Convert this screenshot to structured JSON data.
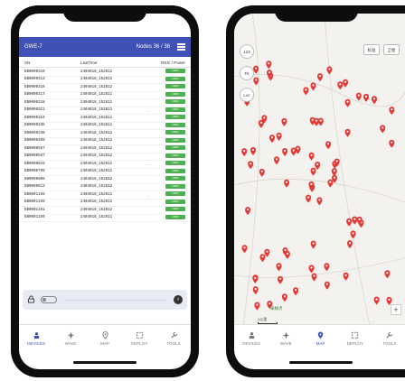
{
  "left_phone": {
    "appbar": {
      "title": "GWE-7",
      "nodes": "Nodes 36 / 36"
    },
    "table": {
      "headers": [
        "SN",
        "LastTime",
        "RSSI / Power"
      ],
      "rows": [
        {
          "sn": "EB0000310",
          "time": "2404018_152812",
          "sig": "",
          "pw": "100%"
        },
        {
          "sn": "EB0000313",
          "time": "2404018_152812",
          "sig": "",
          "pw": "100%"
        },
        {
          "sn": "EB0000316",
          "time": "2404018_152812",
          "sig": "",
          "pw": "100%"
        },
        {
          "sn": "EB0000317",
          "time": "2404018_152811",
          "sig": "",
          "pw": "100%"
        },
        {
          "sn": "EB0000318",
          "time": "2404018_152812",
          "sig": "",
          "pw": "100%"
        },
        {
          "sn": "EB0000321",
          "time": "2404018_152811",
          "sig": "..",
          "pw": "100%"
        },
        {
          "sn": "EB0000324",
          "time": "2404018_152811",
          "sig": "",
          "pw": "100%"
        },
        {
          "sn": "EB0000335",
          "time": "2404018_152811",
          "sig": "",
          "pw": "100%"
        },
        {
          "sn": "EB0000338",
          "time": "2404018_152812",
          "sig": "",
          "pw": "100%"
        },
        {
          "sn": "EB0000409",
          "time": "2404018_152812",
          "sig": "",
          "pw": "100%"
        },
        {
          "sn": "EB0000567",
          "time": "2404018_152812",
          "sig": "",
          "pw": "100%"
        },
        {
          "sn": "EB0000597",
          "time": "2404018_152812",
          "sig": "",
          "pw": "100%"
        },
        {
          "sn": "EB0000619",
          "time": "2404018_152811",
          "sig": "..",
          "pw": "100%"
        },
        {
          "sn": "EB0000798",
          "time": "2404018_152811",
          "sig": "",
          "pw": "100%"
        },
        {
          "sn": "EB0000808",
          "time": "2404018_152812",
          "sig": "",
          "pw": "100%"
        },
        {
          "sn": "EB0000812",
          "time": "2404018_152812",
          "sig": "",
          "pw": "100%"
        },
        {
          "sn": "EB0001156",
          "time": "2404018_152811",
          "sig": "..",
          "pw": "100%"
        },
        {
          "sn": "EB0001159",
          "time": "2404018_152812",
          "sig": "",
          "pw": "100%"
        },
        {
          "sn": "EB0001161",
          "time": "2404018_152812",
          "sig": "",
          "pw": "100%"
        },
        {
          "sn": "EB0001169",
          "time": "2404018_152811",
          "sig": "",
          "pw": "100%"
        }
      ]
    },
    "nav": [
      {
        "label": "DEVICES",
        "icon": "devices-icon"
      },
      {
        "label": "WAVE",
        "icon": "wave-icon"
      },
      {
        "label": "MAP",
        "icon": "map-icon"
      },
      {
        "label": "DEPLOY",
        "icon": "deploy-icon"
      },
      {
        "label": "TOOLS",
        "icon": "tools-icon"
      }
    ],
    "accent": "#3f51b5",
    "power_color": "#4caf50"
  },
  "right_phone": {
    "map_controls": {
      "count": "123",
      "fit": "Fit",
      "loc": "Loc"
    },
    "map_buttons": [
      "标准",
      "卫星"
    ],
    "map_label": "采样点",
    "scale_text": "1公里",
    "zoom": "+",
    "nav": [
      {
        "label": "DEVICES",
        "icon": "devices-icon"
      },
      {
        "label": "WAVE",
        "icon": "wave-icon"
      },
      {
        "label": "MAP",
        "icon": "map-icon"
      },
      {
        "label": "DEPLOY",
        "icon": "deploy-icon"
      },
      {
        "label": "TOOLS",
        "icon": "tools-icon"
      }
    ],
    "pin_color": "#e53935"
  }
}
